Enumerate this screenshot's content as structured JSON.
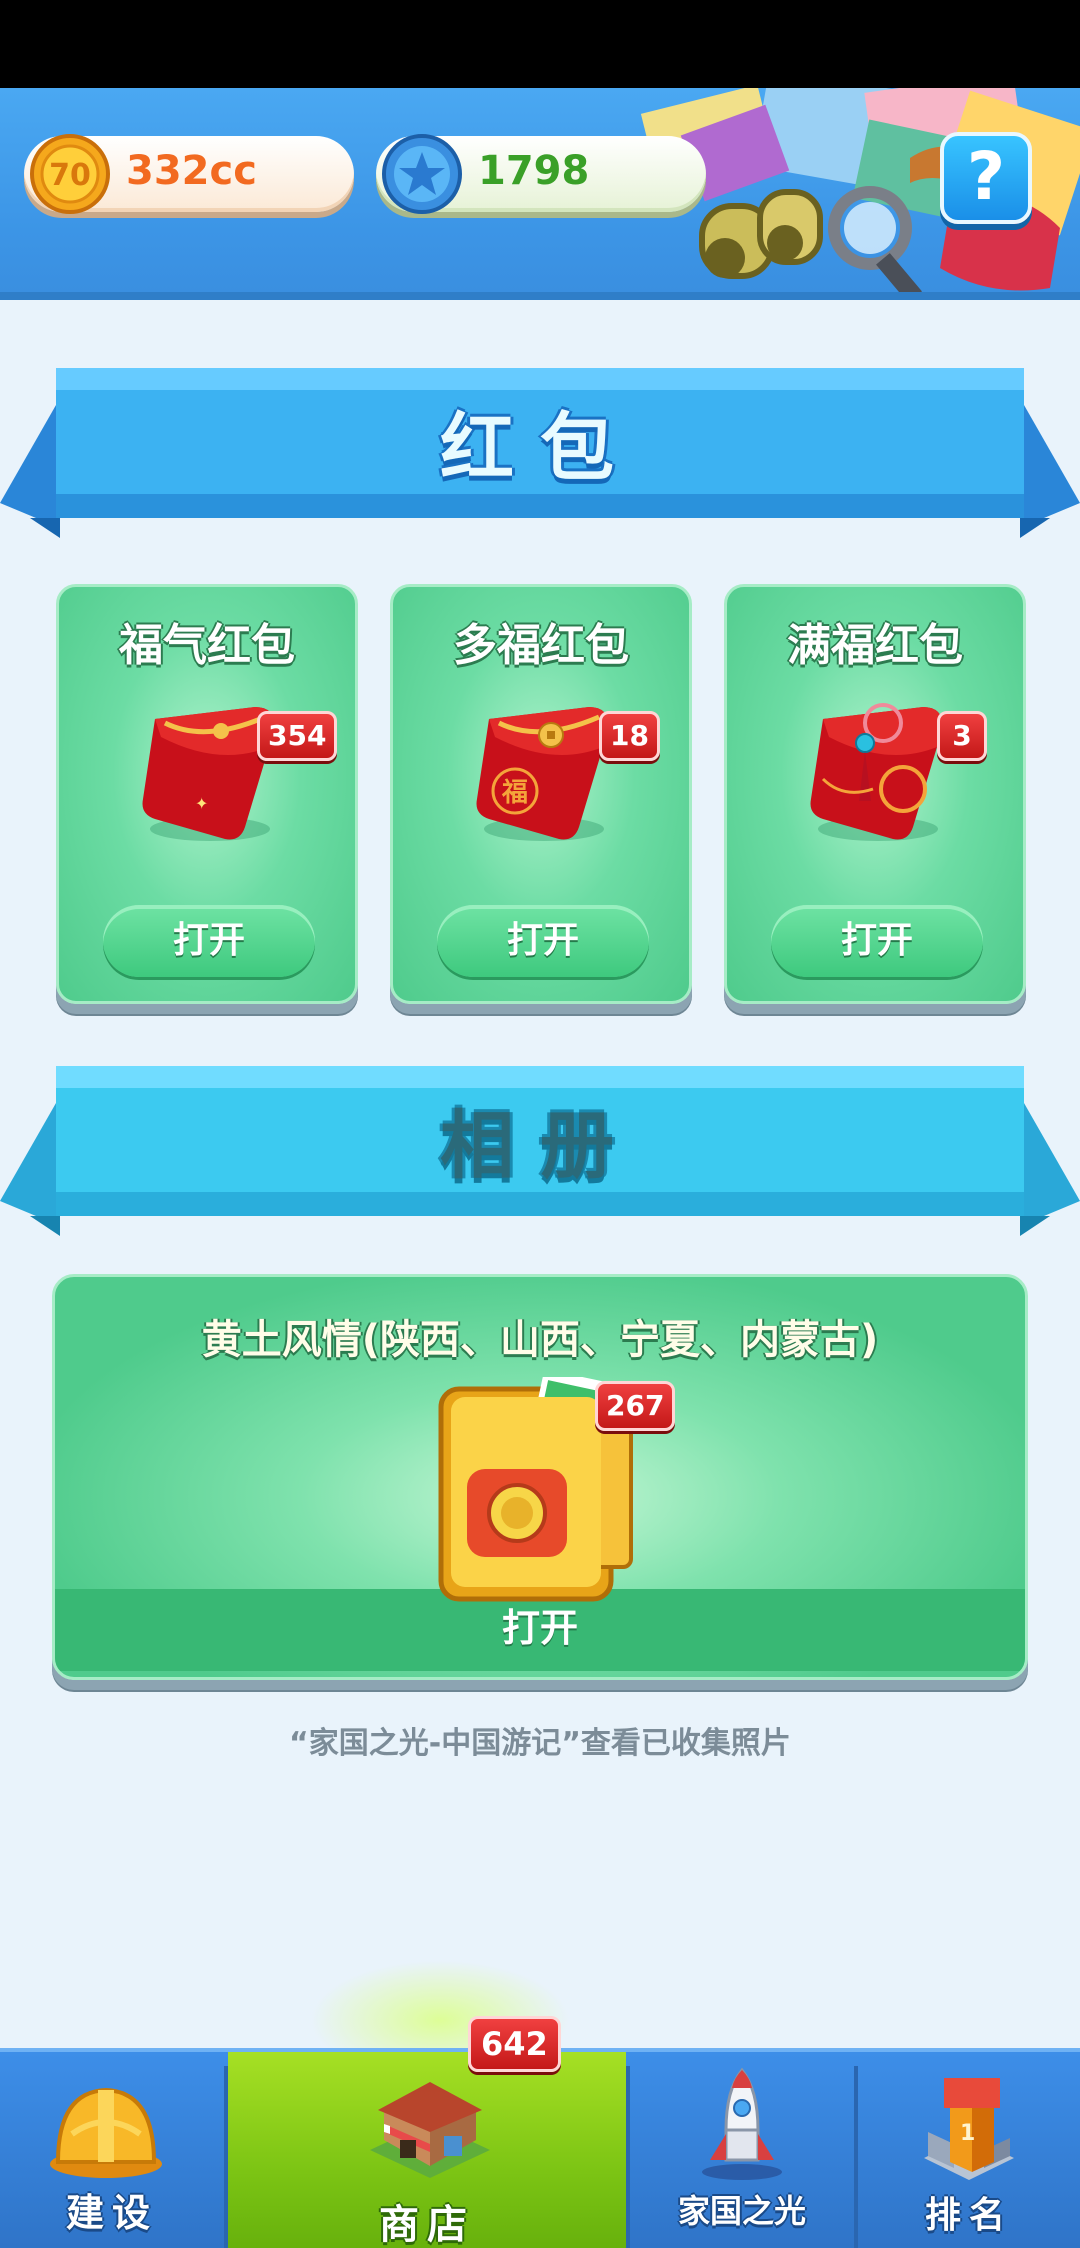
{
  "header": {
    "coins": "332cc",
    "coin_icon_label": "70",
    "stars": "1798",
    "help_label": "?"
  },
  "red_packet_section": {
    "title": "红包",
    "cards": [
      {
        "name": "福气红包",
        "count": "354",
        "open_label": "打开"
      },
      {
        "name": "多福红包",
        "count": "18",
        "open_label": "打开"
      },
      {
        "name": "满福红包",
        "count": "3",
        "open_label": "打开"
      }
    ]
  },
  "album_section": {
    "title": "相册",
    "album_name": "黄土风情(陕西、山西、宁夏、内蒙古)",
    "count": "267",
    "open_label": "打开",
    "note": "“家国之光-中国游记”查看已收集照片"
  },
  "bottom_nav": {
    "items": [
      {
        "label": "建设",
        "icon": "hard-hat-icon"
      },
      {
        "label": "商店",
        "icon": "shop-icon",
        "badge": "642",
        "active": true
      },
      {
        "label": "家国之光",
        "icon": "rocket-icon"
      },
      {
        "label": "排名",
        "icon": "podium-icon"
      }
    ]
  },
  "colors": {
    "header_blue": "#3c95e6",
    "card_green": "#4fcb8c",
    "badge_red": "#d42020",
    "nav_active_green": "#7cc414",
    "coin_text": "#f26a20",
    "star_text": "#3aa028"
  }
}
